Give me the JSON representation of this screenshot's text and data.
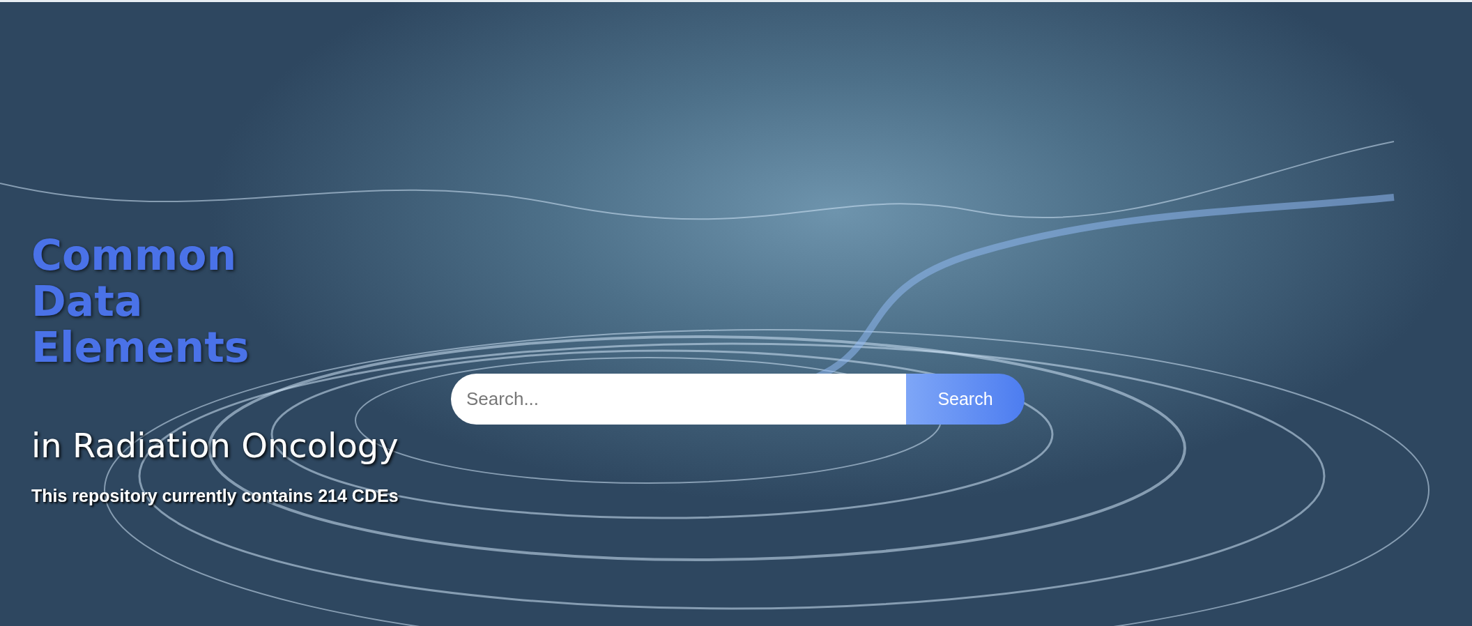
{
  "hero": {
    "title": "Common Data Elements",
    "subtitle": "in Radiation Oncology",
    "summary": "This repository currently contains 214 CDEs"
  },
  "search": {
    "placeholder": "Search...",
    "button": "Search"
  }
}
